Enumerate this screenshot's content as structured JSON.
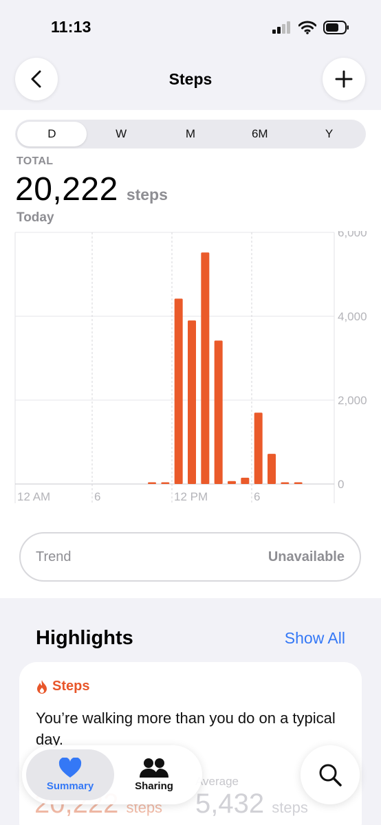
{
  "status": {
    "time": "11:13"
  },
  "header": {
    "title": "Steps"
  },
  "segments": [
    "D",
    "W",
    "M",
    "6M",
    "Y"
  ],
  "summary": {
    "label": "TOTAL",
    "value": "20,222",
    "unit": "steps",
    "period": "Today"
  },
  "chart_data": {
    "type": "bar",
    "color": "#ea5a2a",
    "categories": [
      "0",
      "1",
      "2",
      "3",
      "4",
      "5",
      "6",
      "7",
      "8",
      "9",
      "10",
      "11",
      "12",
      "13",
      "14",
      "15",
      "16",
      "17",
      "18",
      "19",
      "20",
      "21",
      "22",
      "23"
    ],
    "values": [
      0,
      0,
      0,
      0,
      0,
      0,
      0,
      0,
      0,
      0,
      10,
      40,
      4420,
      3900,
      5520,
      3420,
      70,
      150,
      1700,
      720,
      20,
      40,
      0,
      0
    ],
    "x_tick_labels": [
      "12 AM",
      "6",
      "12 PM",
      "6"
    ],
    "y_tick_labels": [
      "6,000",
      "4,000",
      "2,000",
      "0"
    ],
    "ylim": [
      0,
      6000
    ],
    "grid": true
  },
  "trend": {
    "label": "Trend",
    "value": "Unavailable"
  },
  "highlights": {
    "title": "Highlights",
    "show_all": "Show All",
    "card": {
      "category": "Steps",
      "text": "You’re walking more than you do on a typical day.",
      "today_value": "20,222",
      "today_unit": "steps",
      "avg_label": "Average",
      "avg_value": "5,432",
      "avg_unit": "steps"
    }
  },
  "tabs": {
    "summary": "Summary",
    "sharing": "Sharing"
  },
  "colors": {
    "accent": "#3478f6",
    "steps": "#ea5a2a"
  }
}
